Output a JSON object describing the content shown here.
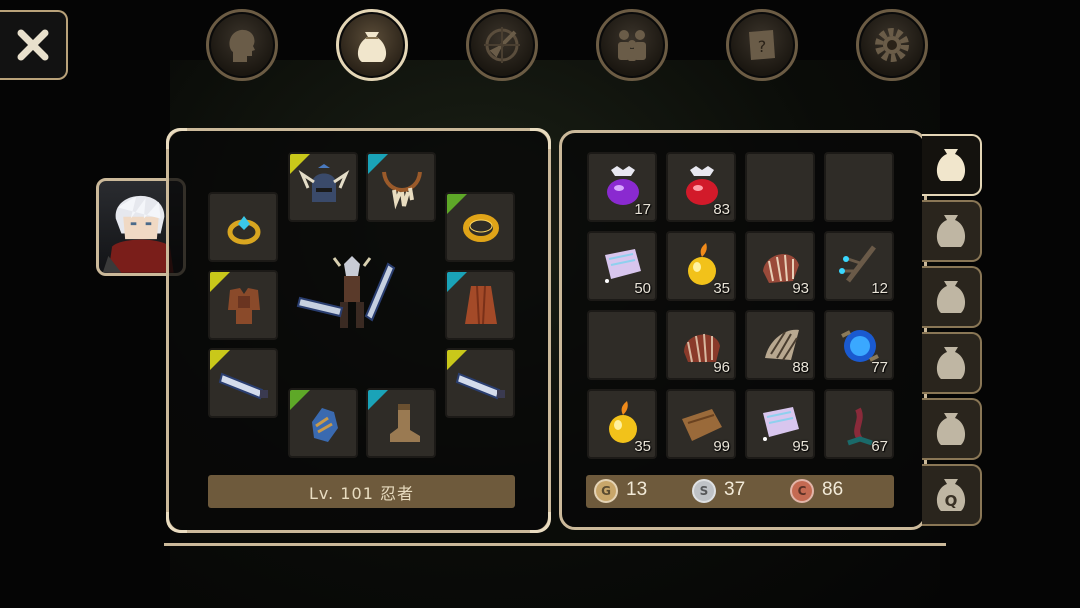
{
  "close": {
    "icon": "close-x-icon"
  },
  "top_tabs": [
    {
      "name": "character",
      "icon": "head-silhouette-icon"
    },
    {
      "name": "inventory",
      "icon": "bag-icon",
      "active": true
    },
    {
      "name": "skills",
      "icon": "compass-sword-icon"
    },
    {
      "name": "party",
      "icon": "people-icon"
    },
    {
      "name": "quests",
      "icon": "scroll-question-icon"
    },
    {
      "name": "settings",
      "icon": "gear-icon"
    }
  ],
  "character": {
    "level_text": "Lv. 101 忍者"
  },
  "equipment": [
    {
      "slot": "helmet",
      "icon": "horned-helmet-icon",
      "rarity": "yellow-green"
    },
    {
      "slot": "necklace",
      "icon": "tooth-necklace-icon",
      "rarity": "cyan"
    },
    {
      "slot": "ring-left",
      "icon": "gem-ring-icon",
      "rarity": "none"
    },
    {
      "slot": "ring-right",
      "icon": "gold-ring-icon",
      "rarity": "green"
    },
    {
      "slot": "armor",
      "icon": "armor-icon",
      "rarity": "yellow"
    },
    {
      "slot": "cape",
      "icon": "cape-icon",
      "rarity": "cyan"
    },
    {
      "slot": "weapon-left",
      "icon": "greatsword-icon",
      "rarity": "yellow"
    },
    {
      "slot": "weapon-right",
      "icon": "greatsword-icon",
      "rarity": "yellow"
    },
    {
      "slot": "gloves",
      "icon": "gauntlet-icon",
      "rarity": "green"
    },
    {
      "slot": "boots",
      "icon": "boot-icon",
      "rarity": "cyan"
    }
  ],
  "inventory": [
    {
      "icon": "purple-potion-icon",
      "qty": "17"
    },
    {
      "icon": "red-potion-icon",
      "qty": "83"
    },
    {
      "icon": "",
      "qty": ""
    },
    {
      "icon": "",
      "qty": ""
    },
    {
      "icon": "crystal-scroll-icon",
      "qty": "50"
    },
    {
      "icon": "golden-apple-icon",
      "qty": "35"
    },
    {
      "icon": "claw-shell-icon",
      "qty": "93"
    },
    {
      "icon": "magic-branch-icon",
      "qty": "12"
    },
    {
      "icon": "",
      "qty": ""
    },
    {
      "icon": "red-claw-icon",
      "qty": "96"
    },
    {
      "icon": "bone-claw-icon",
      "qty": "88"
    },
    {
      "icon": "blue-orb-icon",
      "qty": "77"
    },
    {
      "icon": "golden-apple-icon",
      "qty": "35"
    },
    {
      "icon": "leather-scrap-icon",
      "qty": "99"
    },
    {
      "icon": "crystal-scroll-icon",
      "qty": "95"
    },
    {
      "icon": "tentacle-icon",
      "qty": "67"
    }
  ],
  "currency": {
    "gold": {
      "symbol": "G",
      "value": "13"
    },
    "silver": {
      "symbol": "S",
      "value": "37"
    },
    "copper": {
      "symbol": "C",
      "value": "86"
    }
  },
  "side_tabs": [
    {
      "icon": "bag-icon",
      "active": true
    },
    {
      "icon": "bag-icon"
    },
    {
      "icon": "bag-icon"
    },
    {
      "icon": "bag-icon"
    },
    {
      "icon": "bag-icon"
    },
    {
      "icon": "quest-bag-icon",
      "label": "Q"
    }
  ],
  "colors": {
    "frame": "#cbb99a",
    "slot": "#2f2c27",
    "bar": "#6e5a3c",
    "rarity_yellow": "#c9c81a",
    "rarity_cyan": "#1aa3b8",
    "rarity_green": "#5ea828"
  }
}
